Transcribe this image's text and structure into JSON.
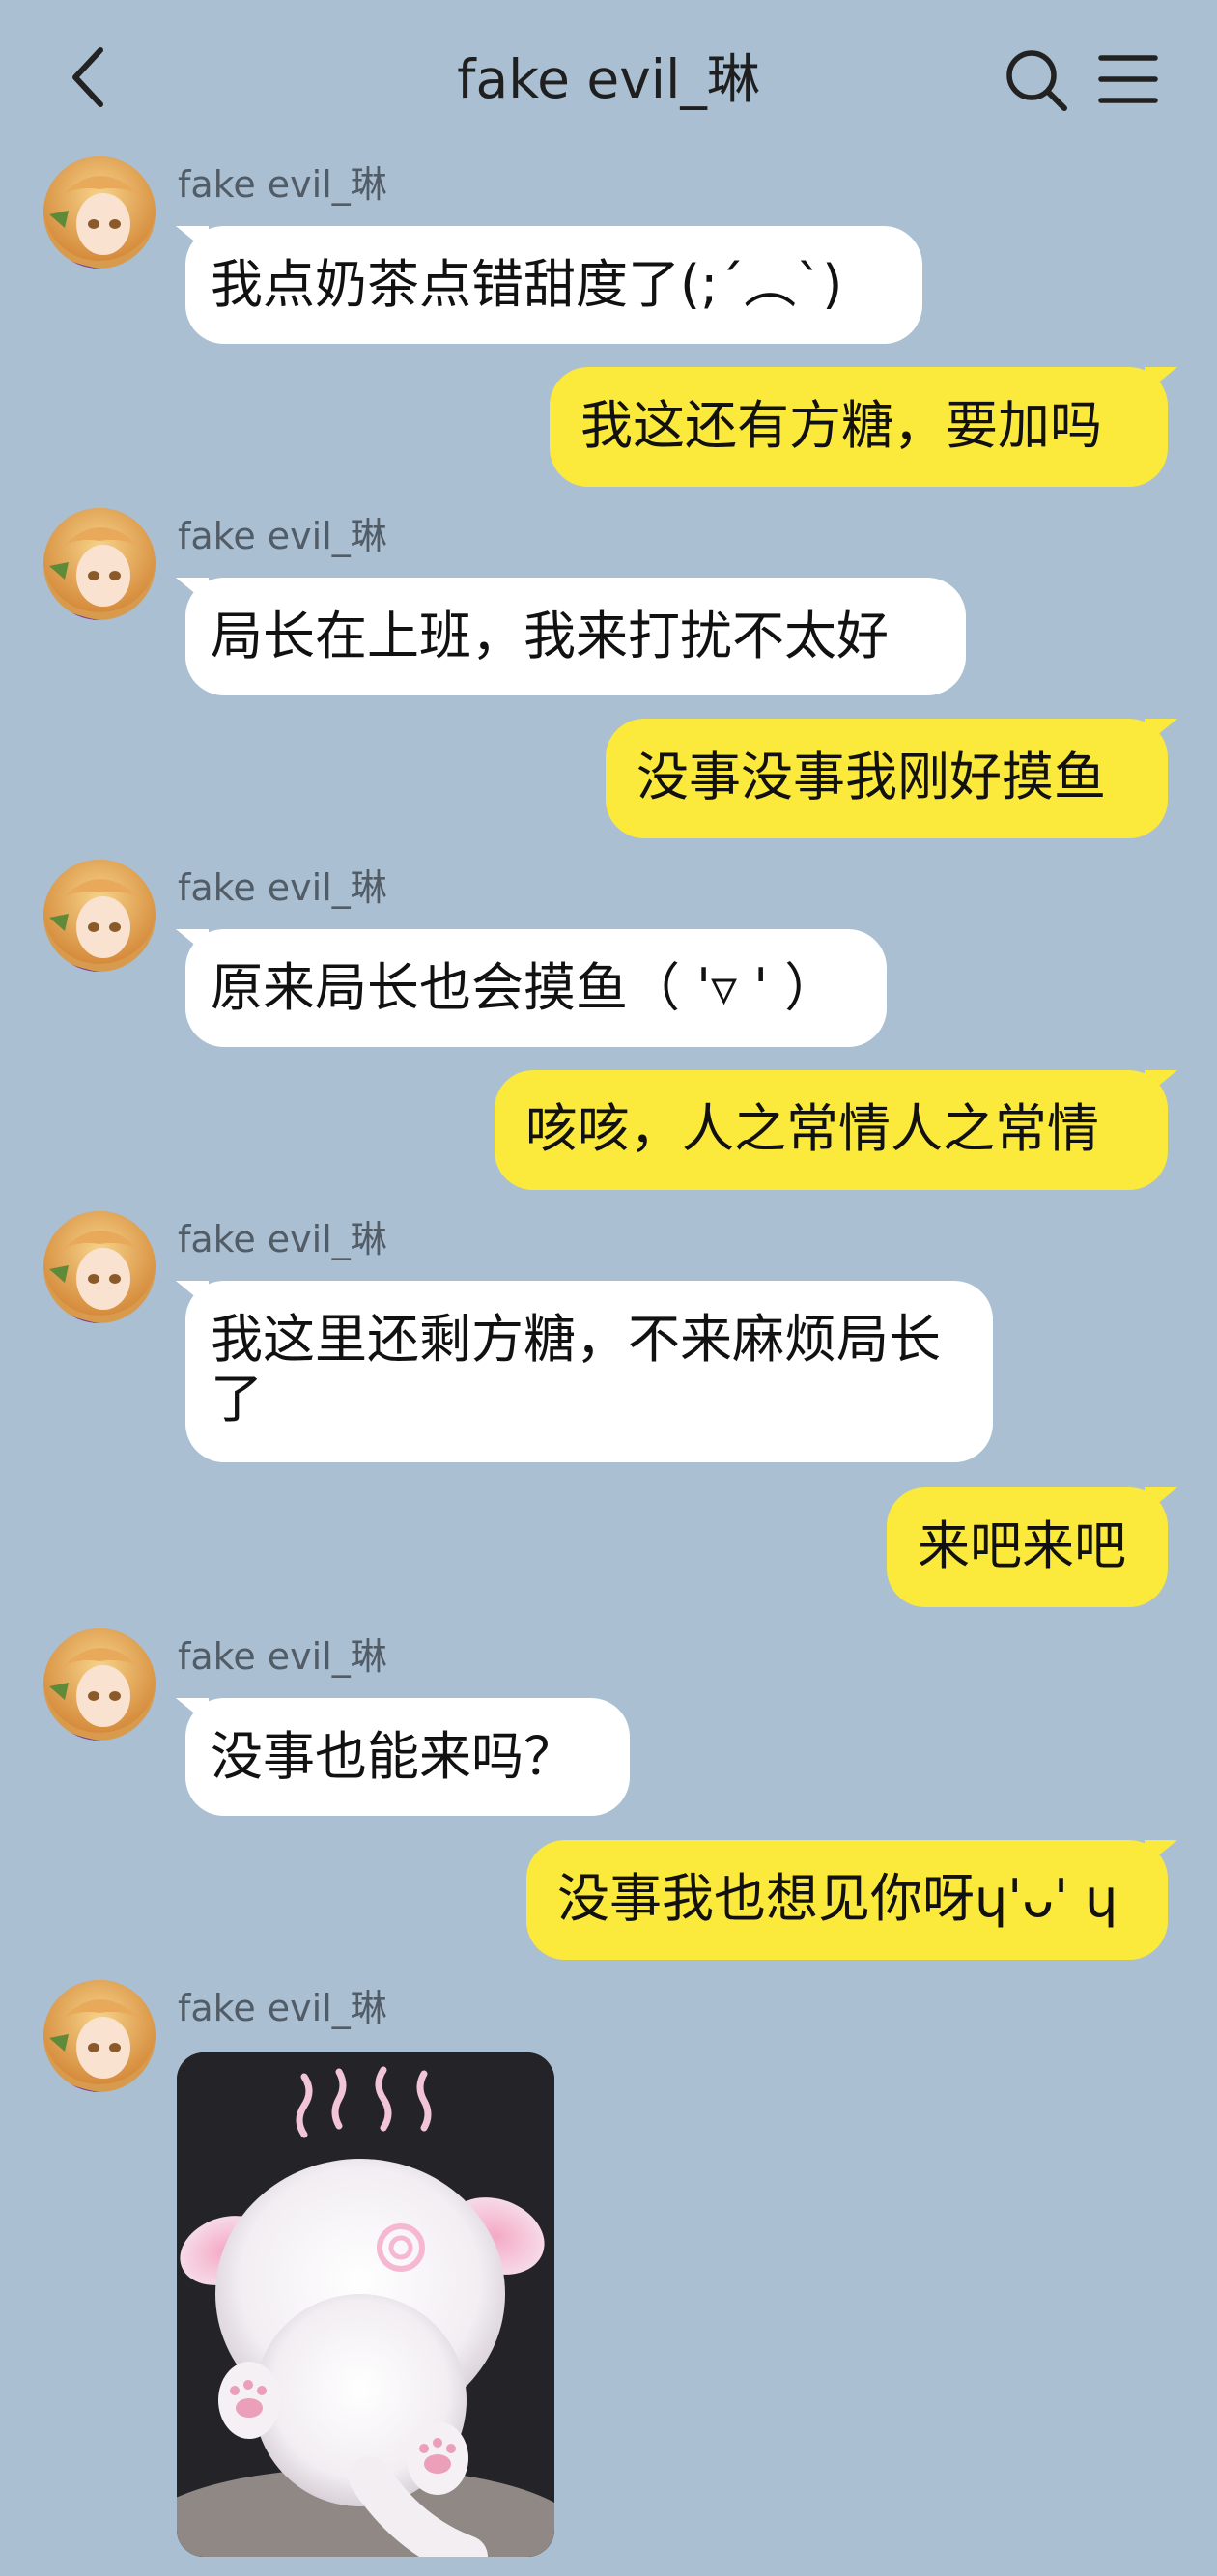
{
  "header": {
    "title": "fake evil_琳"
  },
  "messages": [
    {
      "direction": "in",
      "sender": "fake evil_琳",
      "text": "我点奶茶点错甜度了(;´︵`)"
    },
    {
      "direction": "out",
      "text": "我这还有方糖，要加吗"
    },
    {
      "direction": "in",
      "sender": "fake evil_琳",
      "text": "局长在上班，我来打扰不太好"
    },
    {
      "direction": "out",
      "text": "没事没事我刚好摸鱼"
    },
    {
      "direction": "in",
      "sender": "fake evil_琳",
      "text": "原来局长也会摸鱼（ '▿ ' ）"
    },
    {
      "direction": "out",
      "text": "咳咳，人之常情人之常情"
    },
    {
      "direction": "in",
      "sender": "fake evil_琳",
      "text": "我这里还剩方糖，不来麻烦局长了"
    },
    {
      "direction": "out",
      "text": "来吧来吧"
    },
    {
      "direction": "in",
      "sender": "fake evil_琳",
      "text": "没事也能来吗？"
    },
    {
      "direction": "out",
      "text": "没事我也想见你呀ɥ'ᴗ' ɥ"
    },
    {
      "direction": "in",
      "sender": "fake evil_琳",
      "type": "sticker",
      "sticker": "white-kitten-sticker"
    }
  ],
  "icons": {
    "back": "chevron-left-icon",
    "search": "search-icon",
    "menu": "menu-icon",
    "avatar": "anime-girl-avatar"
  },
  "colors": {
    "background": "#aabfd2",
    "incoming_bubble": "#ffffff",
    "outgoing_bubble": "#fbe93b",
    "sender_name": "#525c66"
  }
}
